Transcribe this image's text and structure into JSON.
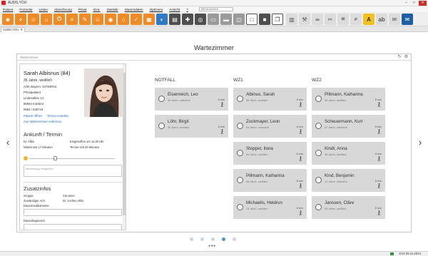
{
  "app": {
    "title": "ALBIS.YOU"
  },
  "window": {
    "minimize": "–",
    "maximize": "□",
    "close": "✕"
  },
  "menu": {
    "items": [
      "Patient",
      "Formular",
      "Listen",
      "Abrechnung",
      "Privat",
      "IGeL",
      "Statistik",
      "Stammdaten",
      "Optionen",
      "Ansicht",
      "?"
    ],
    "search_placeholder": "Menü suchen"
  },
  "toolbar": {
    "icons": [
      "person-icon",
      "person-add-icon",
      "group-icon",
      "waiting-icon",
      "power-icon",
      "document-icon",
      "edit-icon",
      "people-icon",
      "camera-icon",
      "home-icon",
      "check-icon",
      "calendar-icon",
      "user-card-icon",
      "chart-icon",
      "medic-icon",
      "target-icon",
      "cards-icon",
      "card-reader-icon",
      "box-icon",
      "square-outline-icon",
      "square-dark-icon",
      "copy-icon",
      "layout-icon",
      "wrench-icon",
      "link-icon",
      "scissors-icon",
      "tag-icon",
      "search-icon",
      "text-a-icon",
      "text-ab-icon",
      "note-icon",
      "mail-icon"
    ],
    "text_icon_labels": {
      "a": "A",
      "ab": "ab"
    }
  },
  "tabs": {
    "active": "ALBIS.YOU",
    "close": "✕"
  },
  "page": {
    "title": "Wartezimmer"
  },
  "panel": {
    "header": "Wartezimmer",
    "refresh": "↻",
    "settings": "⚙"
  },
  "patient": {
    "name": "Sarah Albisnus (84)",
    "age": "35 Jahre, weiblich",
    "insurance": "AOK Bayern, 54784R44",
    "status": "Privatpatient",
    "street": "Lindenallee 14",
    "city": "56564 Koblenz",
    "phone": "0564 / 546744",
    "link_open": "Patient öffnen",
    "link_appt": "Termin erstellen",
    "link_remove": "Aus Wartezimmer entfernen"
  },
  "arrival": {
    "title": "Ankunft / Termin",
    "doctor": "Dr. Albis",
    "arrived": "Eingetroffen um 11:30 Uhr",
    "waiting": "Wartet seit 17 Minuten",
    "since": "Termin seit 20 Minuten",
    "notes_placeholder": "Bemerkung eingeben..."
  },
  "extra": {
    "title": "Zusatzinfos",
    "group_label": "Gruppe",
    "group_value": "Cerumen",
    "doctor_label": "Zuständiger Arzt",
    "doctor_value": "Dr. Jochen Albis",
    "meds_label": "Dauermedikamente",
    "diag_label": "Dauerdiagnosen"
  },
  "columns": [
    {
      "title": "NOTFALL",
      "cards": [
        {
          "name": "Eisenreich, Leo",
          "desc": "55 Jahre, männlich",
          "time": "8 min"
        },
        {
          "name": "Löhr, Birgit",
          "desc": "35 Jahre, weiblich",
          "time": "8 min"
        }
      ]
    },
    {
      "title": "WZ1",
      "cards": [
        {
          "name": "Albinus, Sarah",
          "desc": "35 Jahre, weiblich",
          "time": "8 min"
        },
        {
          "name": "Zuckmayer, Leon",
          "desc": "64 Jahre, männlich",
          "time": "8 min"
        },
        {
          "name": "Stoppel, Ilona",
          "desc": "52 Jahre, weiblich",
          "time": "8 min"
        },
        {
          "name": "Pillmann, Katharina",
          "desc": "36 Jahre, weiblich",
          "time": "8 min"
        },
        {
          "name": "Michaelis, Heidrun",
          "desc": "78 Jahre, weiblich",
          "time": "8 min"
        }
      ]
    },
    {
      "title": "WZ2",
      "cards": [
        {
          "name": "Pillmann, Katharina",
          "desc": "36 Jahre, weiblich",
          "time": "8 min"
        },
        {
          "name": "Scheuermann, Kurt",
          "desc": "67 Jahre, männlich",
          "time": "8 min"
        },
        {
          "name": "Kindt, Anna",
          "desc": "35 Jahre, weiblich",
          "time": "8 min"
        },
        {
          "name": "Kind, Benjamin",
          "desc": "12 Jahre, männlich",
          "time": "8 min"
        },
        {
          "name": "Janssen, Cläre",
          "desc": "58 Jahre, weiblich",
          "time": "8 min"
        }
      ]
    }
  ],
  "nav": {
    "prev": "‹",
    "next": "›",
    "pages": 5,
    "active_page": 4,
    "add": "+++"
  },
  "status": {
    "time": "4/14 05.11.2014"
  },
  "colors": {
    "accent_orange": "#ef8a24",
    "accent_blue": "#2f79c6",
    "close_red": "#c9302c",
    "card_bg": "#d8d8d8"
  }
}
